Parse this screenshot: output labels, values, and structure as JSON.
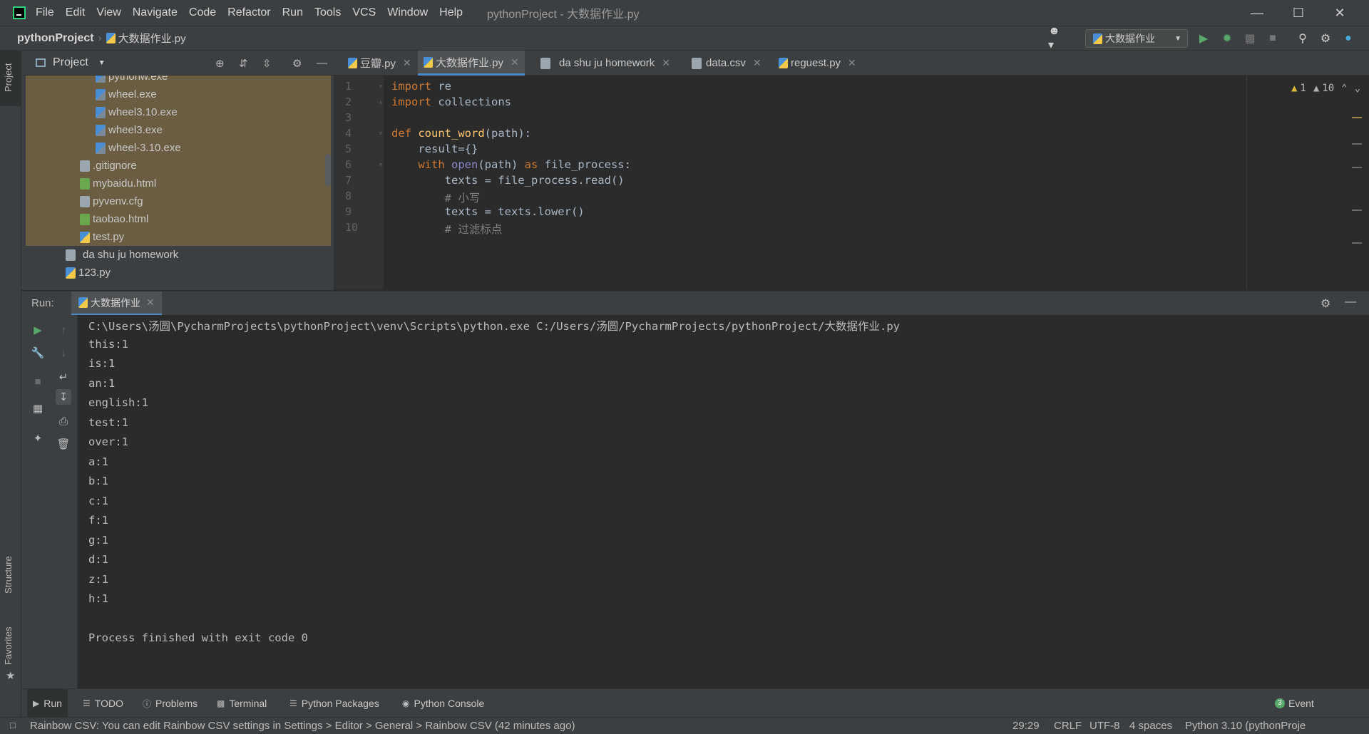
{
  "menu": [
    "File",
    "Edit",
    "View",
    "Navigate",
    "Code",
    "Refactor",
    "Run",
    "Tools",
    "VCS",
    "Window",
    "Help"
  ],
  "window_title": "pythonProject - 大数据作业.py",
  "breadcrumb": {
    "project": "pythonProject",
    "file": "大数据作业.py"
  },
  "run_config": "大数据作业",
  "left_strip": {
    "project": "Project",
    "structure": "Structure",
    "favorites": "Favorites"
  },
  "project_panel": {
    "title": "Project",
    "tree": [
      {
        "name": "pythonw.exe",
        "type": "exe"
      },
      {
        "name": "wheel.exe",
        "type": "exe"
      },
      {
        "name": "wheel3.10.exe",
        "type": "exe"
      },
      {
        "name": "wheel3.exe",
        "type": "exe"
      },
      {
        "name": "wheel-3.10.exe",
        "type": "exe"
      },
      {
        "name": ".gitignore",
        "type": "txt"
      },
      {
        "name": "mybaidu.html",
        "type": "html"
      },
      {
        "name": "pyvenv.cfg",
        "type": "txt"
      },
      {
        "name": "taobao.html",
        "type": "html"
      },
      {
        "name": "test.py",
        "type": "py"
      },
      {
        "name": "da shu ju homework",
        "type": "txt"
      },
      {
        "name": "123.py",
        "type": "py"
      }
    ]
  },
  "editor_tabs": [
    {
      "label": "豆瓣.py",
      "active": false
    },
    {
      "label": "大数据作业.py",
      "active": true
    },
    {
      "label": "da shu ju homework",
      "active": false
    },
    {
      "label": "data.csv",
      "active": false
    },
    {
      "label": "reguest.py",
      "active": false
    }
  ],
  "inspections": {
    "warnings_a": "1",
    "warnings_b": "10"
  },
  "code": {
    "line_numbers": [
      "1",
      "2",
      "3",
      "4",
      "5",
      "6",
      "7",
      "8",
      "9",
      "10"
    ],
    "l1_kw": "import",
    "l1_rest": " re",
    "l2_kw": "import",
    "l2_rest": " collections",
    "l4_kw": "def",
    "l4_fn": "count_word",
    "l4_rest": "(path):",
    "l5": "    result={}",
    "l6_kw": "with",
    "l6_bi": "open",
    "l6_a": "(path) ",
    "l6_kw2": "as",
    "l6_b": " file_process:",
    "l7": "        texts = file_process.read()",
    "l8": "        # 小写",
    "l9": "        texts = texts.lower()",
    "l10": "        # 过滤标点"
  },
  "run_panel": {
    "label": "Run:",
    "tab": "大数据作业",
    "console": [
      "C:\\Users\\汤圆\\PycharmProjects\\pythonProject\\venv\\Scripts\\python.exe C:/Users/汤圆/PycharmProjects/pythonProject/大数据作业.py",
      "this:1",
      "is:1",
      "an:1",
      "english:1",
      "test:1",
      "over:1",
      "a:1",
      "b:1",
      "c:1",
      "f:1",
      "g:1",
      "d:1",
      "z:1",
      "h:1",
      "",
      "Process finished with exit code 0"
    ]
  },
  "bottom_tabs": [
    "Run",
    "TODO",
    "Problems",
    "Terminal",
    "Python Packages",
    "Python Console"
  ],
  "event_log": {
    "count": "3",
    "label": "Event"
  },
  "status": {
    "message": "Rainbow CSV: You can edit Rainbow CSV settings in Settings > Editor > General > Rainbow CSV (42 minutes ago)",
    "position": "29:29",
    "line_sep": "CRLF",
    "encoding": "UTF-8",
    "indent": "4 spaces",
    "interpreter": "Python 3.10 (pythonProje"
  },
  "colors": {
    "accent": "#4a88c7",
    "run_green": "#59a869",
    "warning": "#e0b93c",
    "selection": "#6b5d42"
  }
}
